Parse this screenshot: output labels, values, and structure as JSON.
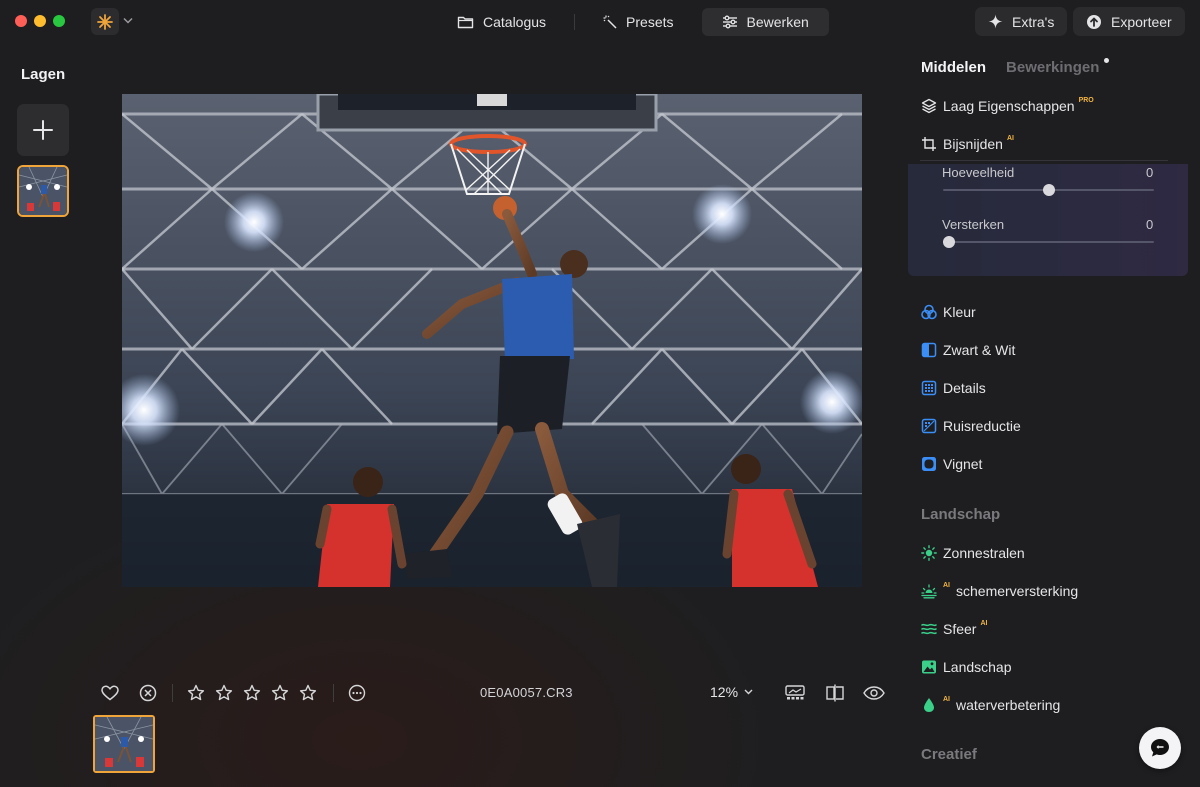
{
  "window": {
    "traffic_lights": [
      "close",
      "minimize",
      "zoom"
    ]
  },
  "topnav": {
    "tabs": [
      {
        "label": "Catalogus",
        "icon": "folder-icon"
      },
      {
        "label": "Presets",
        "icon": "magic-wand-icon"
      },
      {
        "label": "Bewerken",
        "icon": "sliders-icon",
        "active": true
      }
    ],
    "extras_label": "Extra's",
    "export_label": "Exporteer"
  },
  "layers": {
    "title": "Lagen"
  },
  "photo": {
    "filename": "0E0A0057.CR3",
    "zoom": "12%",
    "rating_stars": 5,
    "rating_value": 0
  },
  "panel": {
    "tabs": {
      "tools": "Middelen",
      "edits": "Bewerkingen"
    },
    "layer_properties": {
      "label": "Laag Eigenschappen",
      "badge": "PRO"
    },
    "crop": {
      "label": "Bijsnijden",
      "badge": "AI",
      "sliders": [
        {
          "label": "Hoeveelheid",
          "value": "0",
          "position": 0.5
        },
        {
          "label": "Versterken",
          "value": "0",
          "position": 0.0
        }
      ]
    },
    "tools": [
      {
        "label": "Kleur",
        "icon": "color-wheel-icon"
      },
      {
        "label": "Zwart & Wit",
        "icon": "black-white-icon"
      },
      {
        "label": "Details",
        "icon": "details-grid-icon"
      },
      {
        "label": "Ruisreductie",
        "icon": "noise-icon"
      },
      {
        "label": "Vignet",
        "icon": "vignette-icon"
      }
    ],
    "landscape": {
      "title": "Landschap",
      "items": [
        {
          "label": "Zonnestralen",
          "icon": "sun-icon",
          "badge": ""
        },
        {
          "label": "schemerversterking",
          "icon": "sunset-icon",
          "badge": "AI",
          "badge_before": true
        },
        {
          "label": "Sfeer",
          "icon": "waves-icon",
          "badge": "AI"
        },
        {
          "label": "Landschap",
          "icon": "landscape-icon",
          "badge": ""
        },
        {
          "label": "waterverbetering",
          "icon": "water-drop-icon",
          "badge": "AI",
          "badge_before": true
        }
      ]
    },
    "creative": {
      "title": "Creatief"
    }
  },
  "colors": {
    "accent_orange": "#f0a53a",
    "tool_blue": "#3a8ef6",
    "tool_green": "#3ad08a",
    "badge_gold": "#f2b441"
  }
}
